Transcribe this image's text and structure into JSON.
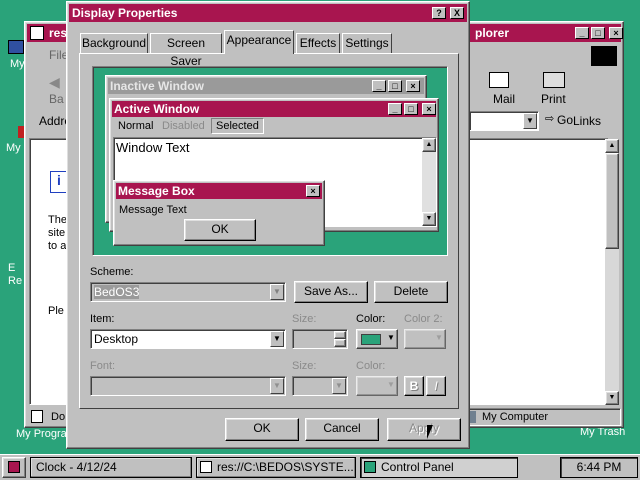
{
  "desktop": {
    "icons": [
      "My",
      "My",
      "E Re",
      "My Programs",
      "My Trash"
    ]
  },
  "explorer": {
    "title_start": "res",
    "title_end": "plorer",
    "menu_file": "File",
    "back_label": "Ba",
    "mail_label": "Mail",
    "print_label": "Print",
    "address_label": "Addre",
    "go_label": "Go",
    "links_label": "Links",
    "body_lines": [
      "The",
      "site",
      "to a",
      "Ple"
    ],
    "status_text": "Do",
    "zone_text": "My Computer"
  },
  "dialog": {
    "title": "Display Properties",
    "help_glyph": "?",
    "close_glyph": "X",
    "tabs": [
      "Background",
      "Screen Saver",
      "Appearance",
      "Effects",
      "Settings"
    ],
    "active_tab_index": 2,
    "preview": {
      "inactive_title": "Inactive Window",
      "active_title": "Active Window",
      "menu": [
        "Normal",
        "Disabled",
        "Selected"
      ],
      "window_text": "Window Text",
      "msgbox_title": "Message Box",
      "msgbox_text": "Message Text",
      "msgbox_ok": "OK"
    },
    "scheme_label": "Scheme:",
    "scheme_value": "BedOS3",
    "save_as": "Save As...",
    "delete": "Delete",
    "item_label": "Item:",
    "item_value": "Desktop",
    "size_label": "Size:",
    "color_label": "Color:",
    "color2_label": "Color 2:",
    "font_label": "Font:",
    "font_size_label": "Size:",
    "font_color_label": "Color:",
    "bold_label": "B",
    "italic_label": "I",
    "ok": "OK",
    "cancel": "Cancel",
    "apply": "Apply",
    "desktop_color": "#2aa37a"
  },
  "taskbar": {
    "items": [
      "Clock - 4/12/24",
      "res://C:\\BEDOS\\SYSTE...",
      "Control Panel"
    ],
    "time": "6:44 PM"
  },
  "colors": {
    "active_title": "#a8154f",
    "inactive_title": "#9a9a9a",
    "desktop": "#2aa37a"
  }
}
